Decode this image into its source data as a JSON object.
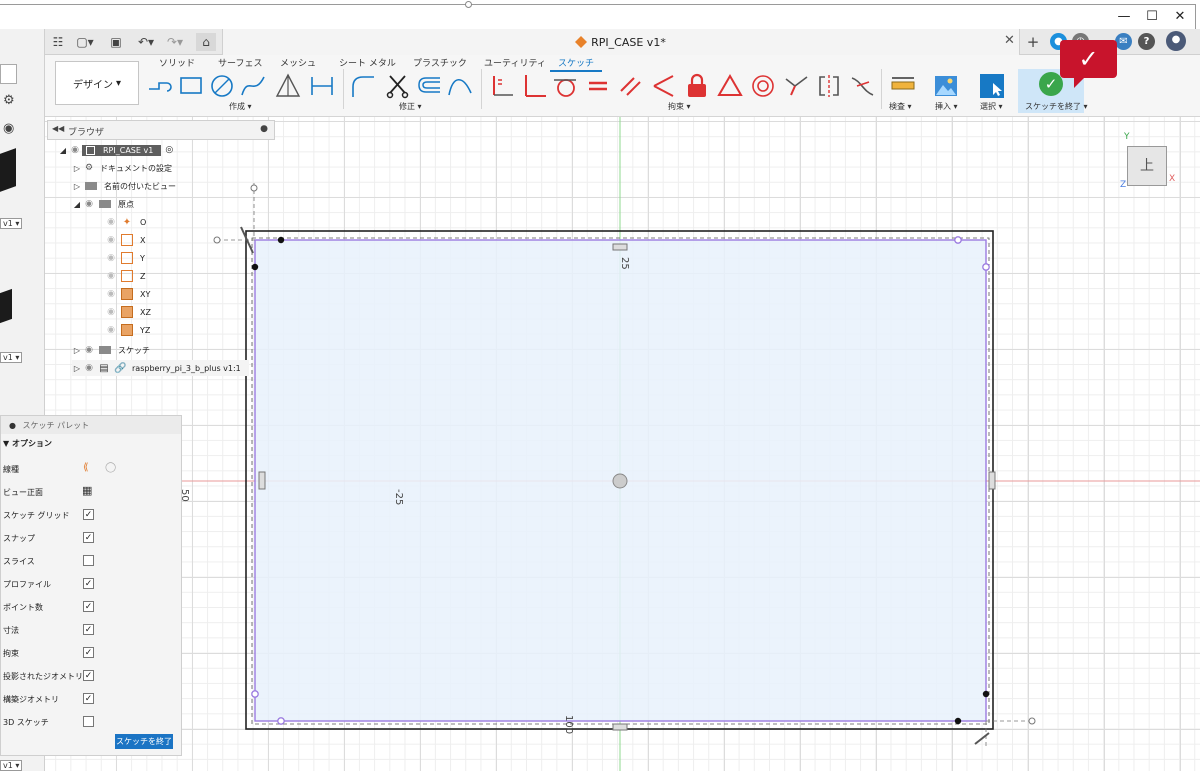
{
  "window": {
    "minimize": "—",
    "maximize": "☐",
    "close": "✕"
  },
  "document": {
    "tab_title": "RPI_CASE v1*",
    "tab_close": "✕"
  },
  "ribbon": {
    "workspace": "デザイン",
    "tabs": [
      "ソリッド",
      "サーフェス",
      "メッシュ",
      "シート メタル",
      "プラスチック",
      "ユーティリティ",
      "スケッチ"
    ],
    "active_tab": "スケッチ",
    "groups": {
      "create": "作成",
      "modify": "修正",
      "constraints": "拘束",
      "inspect": "検査",
      "insert": "挿入",
      "select": "選択",
      "finish": "スケッチを終了"
    }
  },
  "badge": "✓",
  "browser": {
    "title": "ブラウザ",
    "root": "RPI_CASE v1",
    "items": [
      {
        "label": "ドキュメントの設定"
      },
      {
        "label": "名前の付いたビュー"
      },
      {
        "label": "原点"
      },
      {
        "label": "O"
      },
      {
        "label": "X"
      },
      {
        "label": "Y"
      },
      {
        "label": "Z"
      },
      {
        "label": "XY"
      },
      {
        "label": "XZ"
      },
      {
        "label": "YZ"
      },
      {
        "label": "スケッチ"
      },
      {
        "label": "raspberry_pi_3_b_plus v1:1"
      }
    ]
  },
  "palette": {
    "title": "スケッチ パレット",
    "section": "オプション",
    "options": [
      {
        "label": "線種",
        "checked": null
      },
      {
        "label": "ビュー正面",
        "checked": null
      },
      {
        "label": "スケッチ グリッド",
        "checked": true
      },
      {
        "label": "スナップ",
        "checked": true
      },
      {
        "label": "スライス",
        "checked": false
      },
      {
        "label": "プロファイル",
        "checked": true
      },
      {
        "label": "ポイント数",
        "checked": true
      },
      {
        "label": "寸法",
        "checked": true
      },
      {
        "label": "拘束",
        "checked": true
      },
      {
        "label": "投影されたジオメトリ",
        "checked": true
      },
      {
        "label": "構築ジオメトリ",
        "checked": true
      },
      {
        "label": "3D スケッチ",
        "checked": false
      }
    ],
    "finish_button": "スケッチを終了"
  },
  "canvas": {
    "dim_top": "25",
    "dim_left_a": "-25",
    "dim_left_b": "50",
    "dim_bottom": "100",
    "viewcube_face": "上",
    "axis_y": "Y",
    "axis_x": "X",
    "axis_z": "Z"
  },
  "colors": {
    "accent": "#1779c5",
    "finish_green": "#3aa64b",
    "badge_red": "#c8142c",
    "sketch_fill": "#e8f1fb",
    "profile_line": "#9b7be0"
  }
}
